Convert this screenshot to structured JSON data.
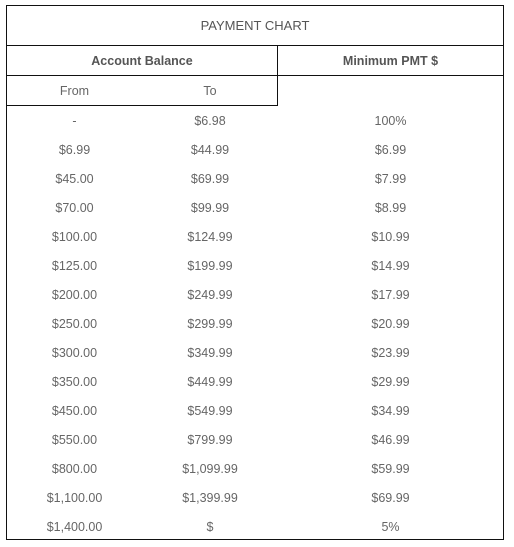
{
  "title": "PAYMENT CHART",
  "headers": {
    "account_balance": "Account Balance",
    "minimum_pmt": "Minimum PMT $",
    "from": "From",
    "to": "To"
  },
  "rows": [
    {
      "from": "-",
      "to": "$6.98",
      "min": "100%"
    },
    {
      "from": "$6.99",
      "to": "$44.99",
      "min": "$6.99"
    },
    {
      "from": "$45.00",
      "to": "$69.99",
      "min": "$7.99"
    },
    {
      "from": "$70.00",
      "to": "$99.99",
      "min": "$8.99"
    },
    {
      "from": "$100.00",
      "to": "$124.99",
      "min": "$10.99"
    },
    {
      "from": "$125.00",
      "to": "$199.99",
      "min": "$14.99"
    },
    {
      "from": "$200.00",
      "to": "$249.99",
      "min": "$17.99"
    },
    {
      "from": "$250.00",
      "to": "$299.99",
      "min": "$20.99"
    },
    {
      "from": "$300.00",
      "to": "$349.99",
      "min": "$23.99"
    },
    {
      "from": "$350.00",
      "to": "$449.99",
      "min": "$29.99"
    },
    {
      "from": "$450.00",
      "to": "$549.99",
      "min": "$34.99"
    },
    {
      "from": "$550.00",
      "to": "$799.99",
      "min": "$46.99"
    },
    {
      "from": "$800.00",
      "to": "$1,099.99",
      "min": "$59.99"
    },
    {
      "from": "$1,100.00",
      "to": "$1,399.99",
      "min": "$69.99"
    },
    {
      "from": "$1,400.00",
      "to": "$",
      "min": "5%"
    }
  ]
}
